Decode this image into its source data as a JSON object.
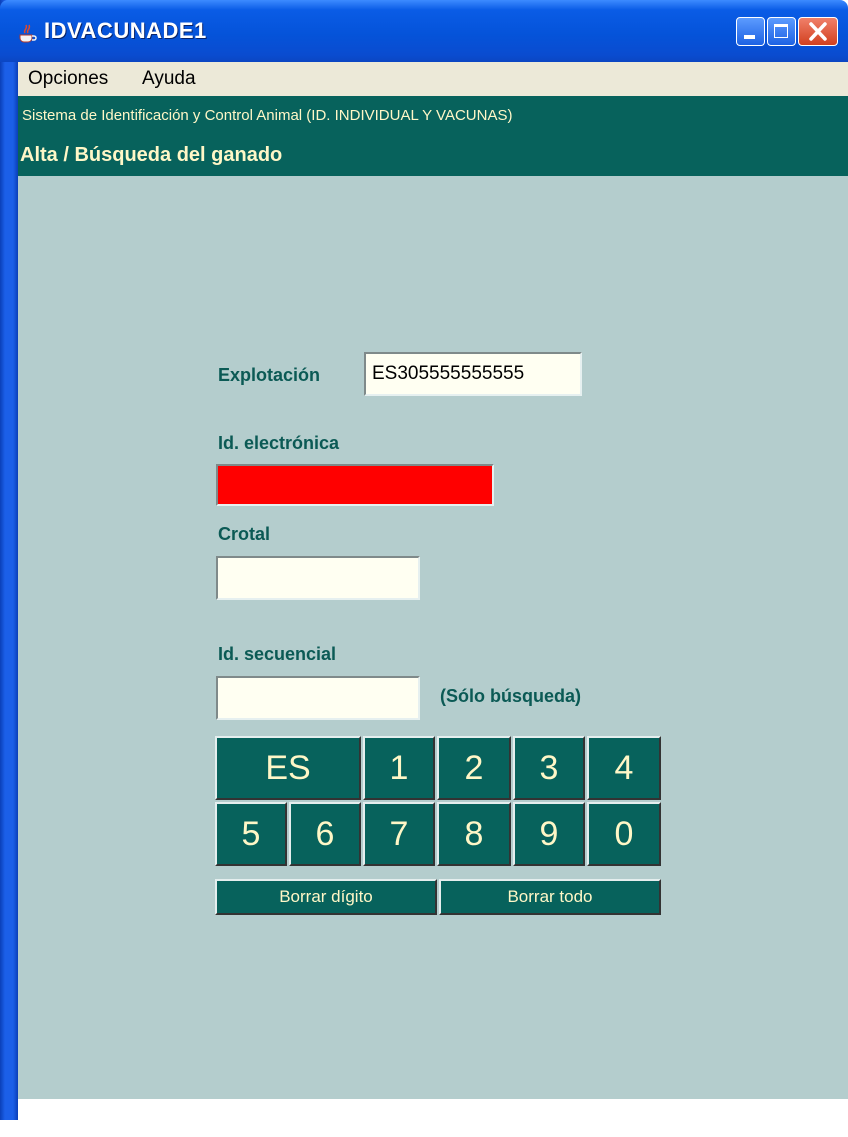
{
  "window": {
    "title": "IDVACUNADE1"
  },
  "menu": {
    "items": [
      "Opciones",
      "Ayuda"
    ]
  },
  "header": {
    "system": "Sistema de Identificación y Control Animal  (ID. INDIVIDUAL Y VACUNAS)",
    "section": "Alta / Búsqueda del ganado"
  },
  "form": {
    "explotacion_label": "Explotación",
    "explotacion_value": "ES305555555555",
    "id_electronica_label": "Id. electrónica",
    "id_electronica_value": "",
    "crotal_label": "Crotal",
    "crotal_value": "",
    "id_secuencial_label": "Id. secuencial",
    "id_secuencial_value": "",
    "solo_busqueda_note": "(Sólo búsqueda)"
  },
  "keypad": {
    "row1": [
      "ES",
      "1",
      "2",
      "3",
      "4"
    ],
    "row2": [
      "5",
      "6",
      "7",
      "8",
      "9",
      "0"
    ],
    "borrar_digito": "Borrar dígito",
    "borrar_todo": "Borrar todo"
  },
  "colors": {
    "header_bg": "#07625c",
    "content_bg": "#b4cdcd",
    "header_text": "#fff7c7",
    "error_field": "#ff0000"
  }
}
